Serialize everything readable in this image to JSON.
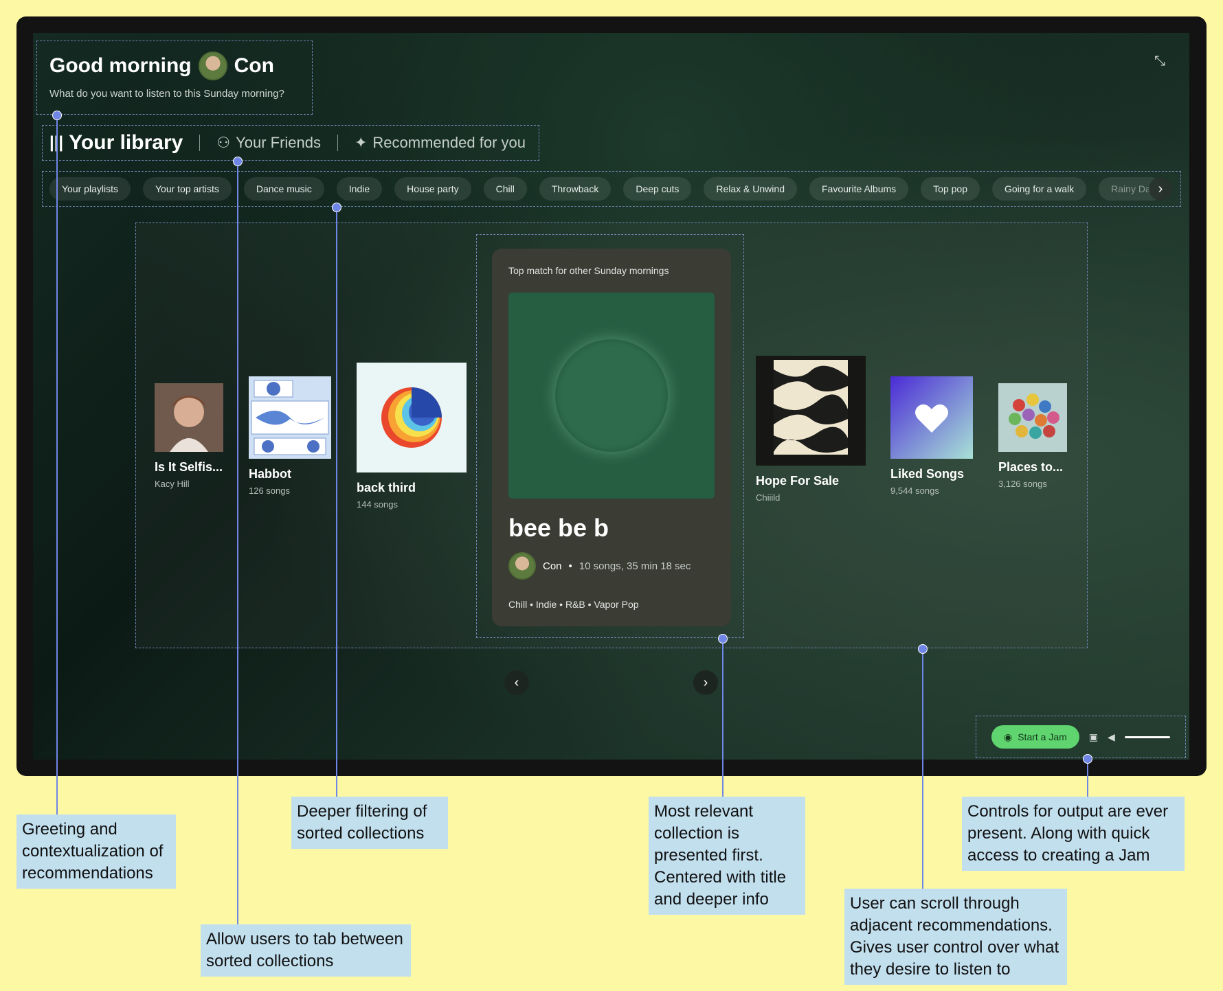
{
  "greeting": {
    "title": "Good morning",
    "user": "Con",
    "subtitle": "What do you want to listen to this Sunday morning?"
  },
  "tabs": [
    {
      "label": "Your library",
      "icon": "library-icon",
      "active": true
    },
    {
      "label": "Your Friends",
      "icon": "friends-icon",
      "active": false
    },
    {
      "label": "Recommended for you",
      "icon": "sparkle-icon",
      "active": false
    }
  ],
  "chips": [
    "Your playlists",
    "Your top artists",
    "Dance music",
    "Indie",
    "House party",
    "Chill",
    "Throwback",
    "Deep cuts",
    "Relax & Unwind",
    "Favourite Albums",
    "Top pop",
    "Going for a walk",
    "Rainy Da"
  ],
  "cards": [
    {
      "title": "Is It Selfis...",
      "meta": "Kacy Hill"
    },
    {
      "title": "Habbot",
      "meta": "126 songs"
    },
    {
      "title": "back third",
      "meta": "144 songs"
    },
    {
      "title": "Hope For Sale",
      "meta": "Chiiild"
    },
    {
      "title": "Liked Songs",
      "meta": "9,544 songs"
    },
    {
      "title": "Places to...",
      "meta": "3,126 songs"
    }
  ],
  "featured": {
    "label": "Top match for other Sunday mornings",
    "title": "bee be b",
    "owner": "Con",
    "details": "10 songs, 35 min 18 sec",
    "genres": "Chill • Indie • R&B • Vapor Pop"
  },
  "controls": {
    "jam_label": "Start a Jam"
  },
  "annotations": [
    "Greeting and contextualization of recommendations",
    "Allow users to tab between sorted collections",
    "Deeper filtering of sorted collections",
    "Most relevant collection is presented first. Centered with title and deeper info",
    "User can scroll through adjacent recommendations. Gives user control over what they desire to listen to",
    "Controls for output are ever present. Along with quick access to creating a Jam"
  ],
  "colors": {
    "background": "#fdf8a4",
    "accent": "#5fd46f",
    "annotation_line": "#6f86e6",
    "annotation_box": "#c2dfee"
  }
}
